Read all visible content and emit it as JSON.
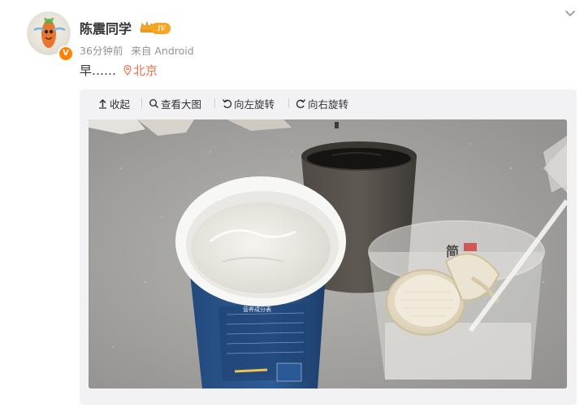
{
  "post": {
    "username": "陈震同学",
    "level_badge": "IV",
    "verified_mark": "V",
    "time_ago": "36分钟前",
    "source": "来自 Android",
    "text": "早……",
    "location": "北京"
  },
  "toolbar": {
    "collapse": "收起",
    "view_large": "查看大图",
    "rotate_left": "向左旋转",
    "rotate_right": "向右旋转"
  },
  "photo": {
    "cup_label_lines": [
      "营养成分表",
      "项目",
      "能量",
      "蛋白质",
      "脂肪"
    ],
    "container_text": "简"
  },
  "icons": {
    "menu": "chevron-down-icon",
    "location": "pin-icon",
    "collapse": "arrow-up-icon",
    "view": "search-icon",
    "rotate_left": "rotate-left-icon",
    "rotate_right": "rotate-right-icon"
  },
  "colors": {
    "location": "#eb7350",
    "badge": "#f5a623",
    "verified": "#ff8200"
  }
}
